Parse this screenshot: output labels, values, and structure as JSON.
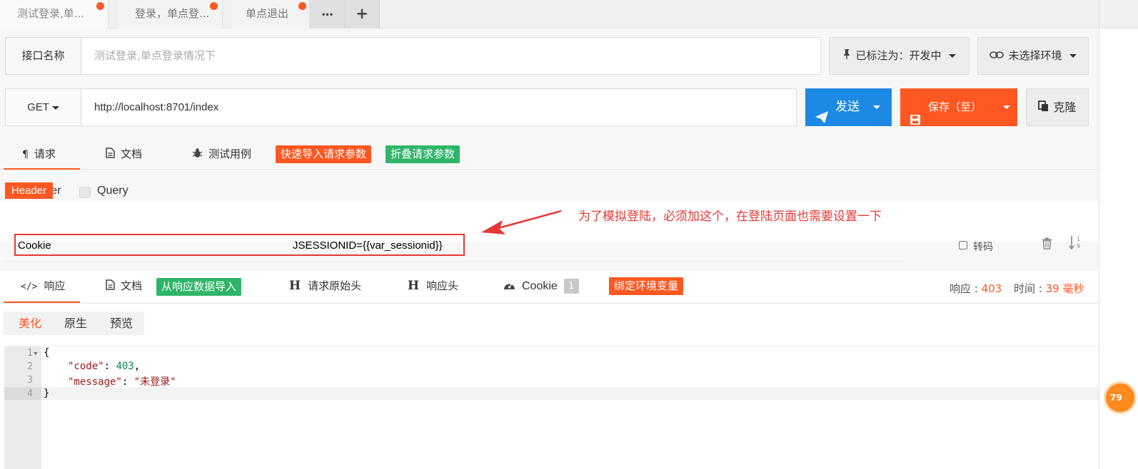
{
  "tabs": [
    {
      "label": "测试登录,单..."
    },
    {
      "label": "登录，单点登..."
    },
    {
      "label": "单点退出"
    }
  ],
  "tab_actions": {
    "more": "•••",
    "add": "+"
  },
  "api": {
    "name_label": "接口名称",
    "name_placeholder": "测试登录,单点登录情况下",
    "status_label": "已标注为：开发中",
    "env_label": "未选择环境",
    "method": "GET",
    "url": "http://localhost:8701/index",
    "send_label": "发送",
    "save_label": "保存（至）",
    "clone_label": "克隆"
  },
  "request_tabs": {
    "request": "请求",
    "docs": "文档",
    "testcase": "测试用例",
    "quick_import": "快速导入请求参数",
    "collapse": "折叠请求参数"
  },
  "param_types": {
    "header": "Header",
    "query": "Query"
  },
  "header_section": {
    "badge": "Header",
    "rows": [
      {
        "key": "Cookie",
        "value": "JSESSIONID={{var_sessionid}}",
        "transcode": "转码"
      }
    ],
    "sort_label": "1\n9"
  },
  "annotation": {
    "text": "为了模拟登陆，必须加这个，在登陆页面也需要设置一下",
    "color": "#e53935"
  },
  "response_tabs": {
    "response": "响应",
    "docs": "文档",
    "import_from_response": "从响应数据导入",
    "raw_request_headers": "请求原始头",
    "response_headers": "响应头",
    "cookie": "Cookie",
    "cookie_count": "1",
    "bind_env": "绑定环境变量"
  },
  "response_meta": {
    "status_label": "响应 : ",
    "status": "403",
    "time_label": "时间 : ",
    "time": "39 毫秒"
  },
  "format_tabs": {
    "pretty": "美化",
    "raw": "原生",
    "preview": "预览"
  },
  "response_body": {
    "lines": [
      "1",
      "2",
      "3",
      "4"
    ],
    "open": "{",
    "code_key": "\"code\"",
    "code_value": "403",
    "message_key": "\"message\"",
    "message_value": "\"未登录\"",
    "close": "}"
  },
  "float_badge": "79",
  "colors": {
    "accent": "#ff5722",
    "primary": "#1e88e5",
    "green": "#2fb56a"
  }
}
